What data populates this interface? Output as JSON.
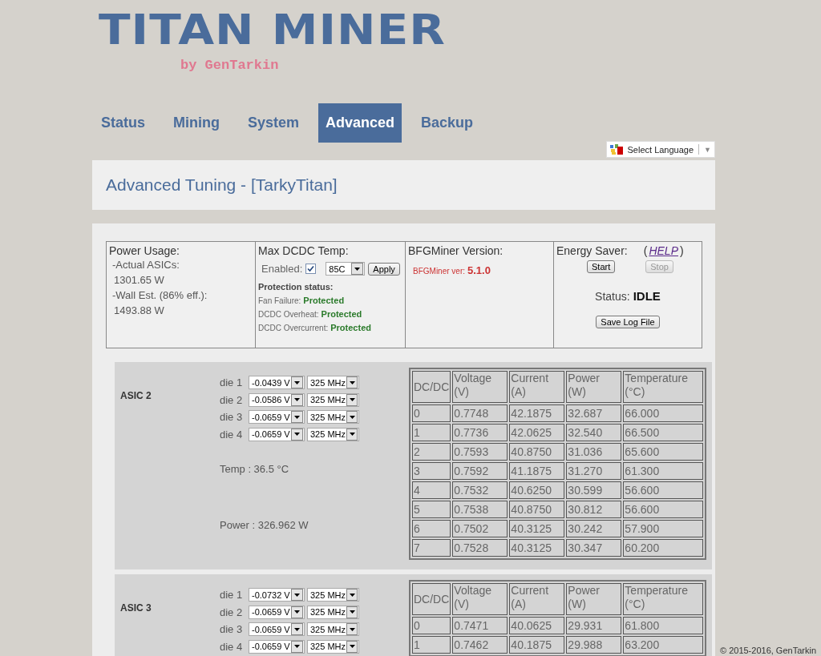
{
  "logo": {
    "title": "TITAN MINER",
    "byline": "by GenTarkin"
  },
  "tabs": [
    {
      "label": "Status",
      "selected": false
    },
    {
      "label": "Mining",
      "selected": false
    },
    {
      "label": "System",
      "selected": false
    },
    {
      "label": "Advanced",
      "selected": true
    },
    {
      "label": "Backup",
      "selected": false
    }
  ],
  "language_selector": {
    "label": "Select Language",
    "caret": "▼"
  },
  "page_title": "Advanced Tuning - [TarkyTitan]",
  "power_usage": {
    "title": "Power Usage:",
    "lines": [
      "-Actual ASICs:",
      "1301.65 W",
      "-Wall Est. (86% eff.):",
      "1493.88 W"
    ]
  },
  "max_dcdc_temp": {
    "title": "Max DCDC Temp:",
    "enabled_label": "Enabled:",
    "enabled": true,
    "temp_select": "85C",
    "apply_button": "Apply",
    "protection_title": "Protection status:",
    "protections": [
      {
        "label": "Fan Failure:",
        "value": "Protected"
      },
      {
        "label": "DCDC Overheat:",
        "value": "Protected"
      },
      {
        "label": "DCDC Overcurrent:",
        "value": "Protected"
      }
    ]
  },
  "bfgminer": {
    "title": "BFGMiner Version:",
    "label": "BFGMiner ver:",
    "version": "5.1.0"
  },
  "energy_saver": {
    "title": "Energy Saver:",
    "help_open": "(",
    "help_link": "HELP",
    "help_close": ")",
    "buttons": [
      {
        "label": "Start",
        "disabled": false
      },
      {
        "label": "Stop",
        "disabled": true
      }
    ],
    "status_label": "Status:",
    "status": "IDLE",
    "save_log_button": "Save Log File"
  },
  "asics": [
    {
      "name": "ASIC 2",
      "dies": [
        {
          "label": "die 1",
          "voltage": "-0.0439 V",
          "frequency": "325 MHz"
        },
        {
          "label": "die 2",
          "voltage": "-0.0586 V",
          "frequency": "325 MHz"
        },
        {
          "label": "die 3",
          "voltage": "-0.0659 V",
          "frequency": "325 MHz"
        },
        {
          "label": "die 4",
          "voltage": "-0.0659 V",
          "frequency": "325 MHz"
        }
      ],
      "temp": "Temp : 36.5 °C",
      "power": "Power : 326.962 W",
      "columns": [
        {
          "label": "DC/DC"
        },
        {
          "label": "Voltage",
          "unit": "(V)"
        },
        {
          "label": "Current",
          "unit": "(A)"
        },
        {
          "label": "Power",
          "unit": "(W)"
        },
        {
          "label": "Temperature",
          "unit": "(°C)"
        }
      ],
      "rows": [
        [
          "0",
          "0.7748",
          "42.1875",
          "32.687",
          "66.000"
        ],
        [
          "1",
          "0.7736",
          "42.0625",
          "32.540",
          "66.500"
        ],
        [
          "2",
          "0.7593",
          "40.8750",
          "31.036",
          "65.600"
        ],
        [
          "3",
          "0.7592",
          "41.1875",
          "31.270",
          "61.300"
        ],
        [
          "4",
          "0.7532",
          "40.6250",
          "30.599",
          "56.600"
        ],
        [
          "5",
          "0.7538",
          "40.8750",
          "30.812",
          "56.600"
        ],
        [
          "6",
          "0.7502",
          "40.3125",
          "30.242",
          "57.900"
        ],
        [
          "7",
          "0.7528",
          "40.3125",
          "30.347",
          "60.200"
        ]
      ]
    },
    {
      "name": "ASIC 3",
      "dies": [
        {
          "label": "die 1",
          "voltage": "-0.0732 V",
          "frequency": "325 MHz"
        },
        {
          "label": "die 2",
          "voltage": "-0.0659 V",
          "frequency": "325 MHz"
        },
        {
          "label": "die 3",
          "voltage": "-0.0659 V",
          "frequency": "325 MHz"
        },
        {
          "label": "die 4",
          "voltage": "-0.0659 V",
          "frequency": "325 MHz"
        }
      ],
      "columns": [
        {
          "label": "DC/DC"
        },
        {
          "label": "Voltage",
          "unit": "(V)"
        },
        {
          "label": "Current",
          "unit": "(A)"
        },
        {
          "label": "Power",
          "unit": "(W)"
        },
        {
          "label": "Temperature",
          "unit": "(°C)"
        }
      ],
      "rows": [
        [
          "0",
          "0.7471",
          "40.0625",
          "29.931",
          "61.800"
        ],
        [
          "1",
          "0.7462",
          "40.1875",
          "29.988",
          "63.200"
        ]
      ]
    }
  ],
  "footer": "© 2015-2016, GenTarkin"
}
